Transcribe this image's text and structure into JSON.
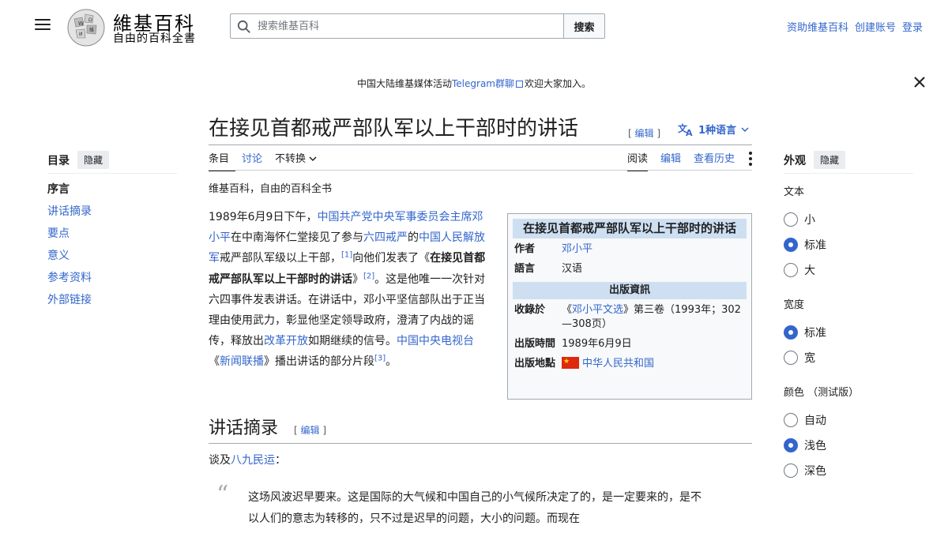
{
  "header": {
    "logo_title": "維基百科",
    "logo_tagline": "自由的百科全書",
    "search_placeholder": "搜索维基百科",
    "search_button": "搜索",
    "user_links": [
      "资助维基百科",
      "创建账号",
      "登录"
    ]
  },
  "banner": {
    "prefix": "中国大陆维基媒体活动",
    "link": "Telegram群聊",
    "suffix": "欢迎大家加入。"
  },
  "article": {
    "title": "在接见首都戒严部队军以上干部时的讲话",
    "edit_label": "编辑",
    "languages": "1种语言",
    "tabs_left": [
      "条目",
      "讨论",
      "不转换"
    ],
    "tabs_right": [
      "阅读",
      "编辑",
      "查看历史"
    ],
    "site_sub": "维基百科，自由的百科全书"
  },
  "toc": {
    "title": "目录",
    "hide": "隐藏",
    "items": [
      "序言",
      "讲话摘录",
      "要点",
      "意义",
      "参考资料",
      "外部链接"
    ]
  },
  "body": {
    "t1": "1989年6月9日下午，",
    "l1": "中国共产党中央军事委员会主席",
    "l2": "邓小平",
    "t2": "在中南海怀仁堂接见了参与",
    "l3": "六四戒严",
    "t3": "的",
    "l4": "中国人民解放军",
    "t4": "戒严部队军级以上干部，",
    "ref1": "[1]",
    "t5": "向他们发表了《",
    "bold": "在接见首都戒严部队军以上干部时的讲话",
    "t6": "》",
    "ref2": "[2]",
    "t7": "。这是他唯一一次针对六四事件发表讲话。在讲话中，邓小平坚信部队出于正当理由使用武力，彰显他坚定领导政府，澄清了内战的谣传，释放出",
    "l5": "改革开放",
    "t8": "如期继续的信号。",
    "l6": "中国中央电视台",
    "t9": "《",
    "l7": "新闻联播",
    "t10": "》播出讲话的部分片段",
    "ref3": "[3]",
    "t11": "。"
  },
  "infobox": {
    "title": "在接见首都戒严部队军以上干部时的讲话",
    "author_label": "作者",
    "author": "邓小平",
    "lang_label": "語言",
    "lang": "汉语",
    "pub_section": "出版資訊",
    "collected_label": "收錄於",
    "collected_pre": "《",
    "collected_link": "邓小平文选",
    "collected_post": "》第三卷（1993年；302—308页）",
    "time_label": "出版時間",
    "time": "1989年6月9日",
    "place_label": "出版地點",
    "place": "中华人民共和国"
  },
  "section": {
    "title": "讲话摘录",
    "edit": "编辑",
    "intro_pre": "谈及",
    "intro_link": "八九民运",
    "intro_post": "：",
    "quote": "这场风波迟早要来。这是国际的大气候和中国自己的小气候所决定了的，是一定要来的，是不以人们的意志为转移的，只不过是迟早的问题，大小的问题。而现在"
  },
  "appearance": {
    "title": "外观",
    "hide": "隐藏",
    "text_label": "文本",
    "text_options": [
      "小",
      "标准",
      "大"
    ],
    "width_label": "宽度",
    "width_options": [
      "标准",
      "宽"
    ],
    "color_label": "颜色 （测试版）",
    "color_options": [
      "自动",
      "浅色",
      "深色"
    ]
  }
}
